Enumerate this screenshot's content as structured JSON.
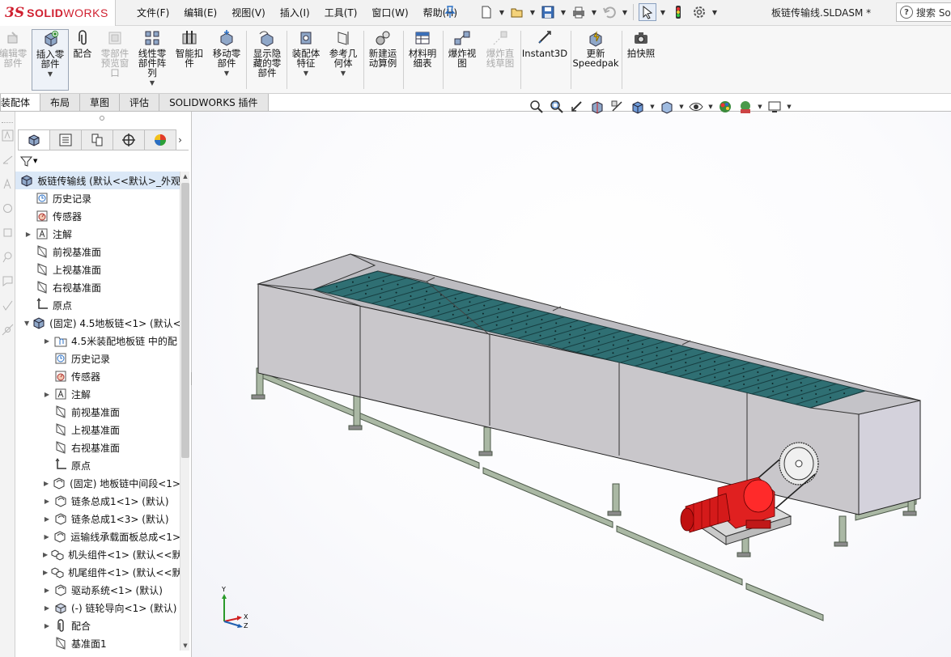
{
  "app": {
    "logo_ds": "3S",
    "logo_solid": "SOLID",
    "logo_works": "WORKS",
    "document_title": "板链传输线.SLDASM *",
    "search_label": "搜索 So"
  },
  "menu": [
    "文件(F)",
    "编辑(E)",
    "视图(V)",
    "插入(I)",
    "工具(T)",
    "窗口(W)",
    "帮助(H)"
  ],
  "quick_access": [
    "new-icon",
    "open-icon",
    "save-icon",
    "print-icon",
    "undo-icon",
    "select-icon",
    "rebuild-icon",
    "options-icon"
  ],
  "command_manager": {
    "tools": [
      {
        "label": "编辑零\n部件",
        "enabled": false
      },
      {
        "label": "插入零\n部件",
        "enabled": true
      },
      {
        "label": "配合",
        "enabled": true
      },
      {
        "label": "零部件\n预览窗\n口",
        "enabled": false
      },
      {
        "label": "线性零\n部件阵\n列",
        "enabled": true
      },
      {
        "label": "智能扣\n件",
        "enabled": true
      },
      {
        "label": "移动零\n部件",
        "enabled": true
      },
      {
        "label": "显示隐\n藏的零\n部件",
        "enabled": true
      },
      {
        "label": "装配体\n特征",
        "enabled": true
      },
      {
        "label": "参考几\n何体",
        "enabled": true
      },
      {
        "label": "新建运\n动算例",
        "enabled": true
      },
      {
        "label": "材料明\n细表",
        "enabled": true
      },
      {
        "label": "爆炸视\n图",
        "enabled": true
      },
      {
        "label": "爆炸直\n线草图",
        "enabled": false
      },
      {
        "label": "Instant3D",
        "enabled": true
      },
      {
        "label": "更新\nSpeedpak",
        "enabled": true
      },
      {
        "label": "拍快照",
        "enabled": true
      }
    ],
    "tabs": [
      "装配体",
      "布局",
      "草图",
      "评估",
      "SOLIDWORKS 插件"
    ],
    "active_tab": "装配体"
  },
  "feature_tree": {
    "root": "板链传输线  (默认<<默认>_外观",
    "items": [
      {
        "text": "历史记录",
        "level": 1,
        "expand": ""
      },
      {
        "text": "传感器",
        "level": 1,
        "expand": ""
      },
      {
        "text": "注解",
        "level": 1,
        "expand": "▶"
      },
      {
        "text": "前视基准面",
        "level": 1,
        "expand": ""
      },
      {
        "text": "上视基准面",
        "level": 1,
        "expand": ""
      },
      {
        "text": "右视基准面",
        "level": 1,
        "expand": ""
      },
      {
        "text": "原点",
        "level": 1,
        "expand": ""
      },
      {
        "text": "(固定) 4.5地板链<1> (默认<",
        "level": 1,
        "expand": "▼"
      },
      {
        "text": "4.5米装配地板链 中的配",
        "level": 2,
        "expand": "▶"
      },
      {
        "text": "历史记录",
        "level": 2,
        "expand": ""
      },
      {
        "text": "传感器",
        "level": 2,
        "expand": ""
      },
      {
        "text": "注解",
        "level": 2,
        "expand": "▶"
      },
      {
        "text": "前视基准面",
        "level": 2,
        "expand": ""
      },
      {
        "text": "上视基准面",
        "level": 2,
        "expand": ""
      },
      {
        "text": "右视基准面",
        "level": 2,
        "expand": ""
      },
      {
        "text": "原点",
        "level": 2,
        "expand": ""
      },
      {
        "text": "(固定) 地板链中间段<1>",
        "level": 2,
        "expand": "▶"
      },
      {
        "text": "链条总成1<1> (默认)",
        "level": 2,
        "expand": "▶"
      },
      {
        "text": "链条总成1<3> (默认)",
        "level": 2,
        "expand": "▶"
      },
      {
        "text": "运输线承载面板总成<1>",
        "level": 2,
        "expand": "▶"
      },
      {
        "text": "机头组件<1> (默认<<默",
        "level": 2,
        "expand": "▶"
      },
      {
        "text": "机尾组件<1> (默认<<默",
        "level": 2,
        "expand": "▶"
      },
      {
        "text": "驱动系统<1> (默认)",
        "level": 2,
        "expand": "▶"
      },
      {
        "text": "(-) 链轮导向<1> (默认)",
        "level": 2,
        "expand": "▶"
      },
      {
        "text": "配合",
        "level": 2,
        "expand": "▶"
      },
      {
        "text": "基准面1",
        "level": 2,
        "expand": ""
      }
    ]
  },
  "triad": {
    "x": "X",
    "y": "Y",
    "z": "Z"
  },
  "colors": {
    "housing": "#c9c7cb",
    "housing_end": "#d4d2dc",
    "slats": "#2f6f73",
    "frame": "#aab8a4",
    "motor": "#e02020",
    "accent": "#1f5fb0"
  }
}
